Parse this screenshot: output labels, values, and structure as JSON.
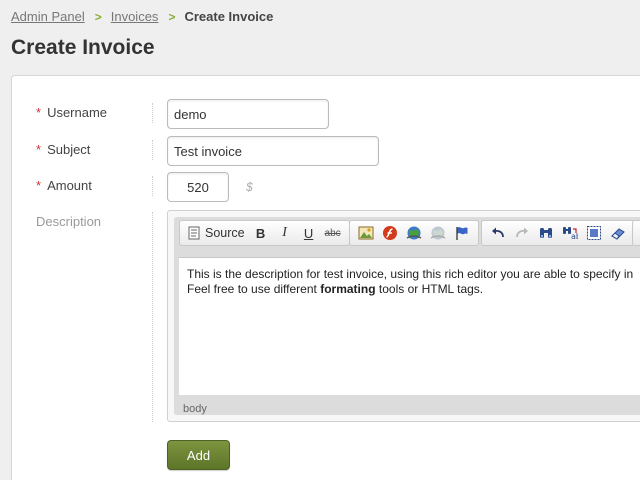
{
  "breadcrumb": {
    "items": [
      "Admin Panel",
      "Invoices"
    ],
    "current": "Create Invoice",
    "separator": ">"
  },
  "page": {
    "title": "Create Invoice"
  },
  "form": {
    "required_mark": "*",
    "username": {
      "label": "Username",
      "value": "demo"
    },
    "subject": {
      "label": "Subject",
      "value": "Test invoice"
    },
    "amount": {
      "label": "Amount",
      "value": "520",
      "unit": "$"
    },
    "description": {
      "label": "Description",
      "line1": "This is the description for test invoice, using this rich editor you are able to specify in",
      "line2_before": "Feel free to use different ",
      "line2_bold": "formating",
      "line2_after": " tools or HTML tags.",
      "status": "body"
    },
    "submit_label": "Add"
  },
  "toolbar": {
    "source_label": "Source",
    "bold_label": "B",
    "italic_label": "I",
    "underline_label": "U",
    "strike_label": "abc"
  },
  "colors": {
    "accent": "#8aac3c",
    "button": "#6b8434",
    "required": "#cc3333"
  }
}
